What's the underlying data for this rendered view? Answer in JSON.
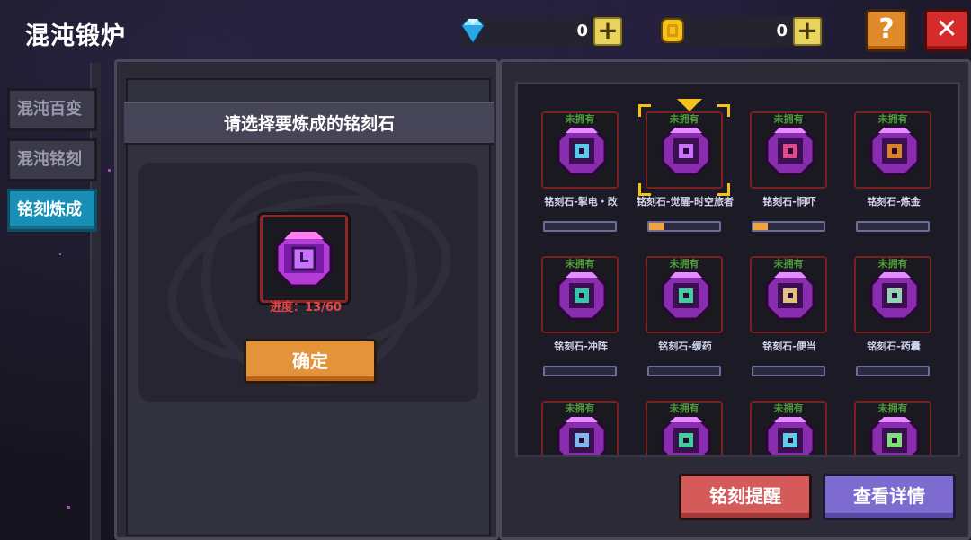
{
  "title": "混沌锻炉",
  "currency": {
    "gems": {
      "value": "0",
      "icon": "diamond-icon",
      "color": "#4fc3f7"
    },
    "coins": {
      "value": "0",
      "icon": "gold-coin-icon",
      "color": "#f4c21b"
    },
    "add_label": "+"
  },
  "help_label": "?",
  "close_label": "✕",
  "sidebar": {
    "tabs": [
      {
        "label": "混沌百变",
        "active": false
      },
      {
        "label": "混沌铭刻",
        "active": false
      },
      {
        "label": "铭刻炼成",
        "active": true
      }
    ]
  },
  "left_panel": {
    "header": "请选择要炼成的铭刻石",
    "selected_item_icon": "purple-gem-icon",
    "progress_label": "进度：13/60",
    "progress": {
      "current": 13,
      "total": 60
    },
    "confirm_label": "确定"
  },
  "grid": {
    "owned_label": "未拥有",
    "items": [
      {
        "name": "铭刻石-掣电・改",
        "icon": "lightning-rune-icon",
        "progress": 0,
        "selected": false
      },
      {
        "name": "铭刻石-觉醒-时空旅者",
        "icon": "clock-rune-icon",
        "progress": 0.217,
        "selected": true
      },
      {
        "name": "铭刻石-恫吓",
        "icon": "mask-rune-icon",
        "progress": 0.2,
        "selected": false
      },
      {
        "name": "铭刻石-炼金",
        "icon": "cauldron-rune-icon",
        "progress": 0,
        "selected": false
      },
      {
        "name": "铭刻石-冲阵",
        "icon": "charge-rune-icon",
        "progress": 0,
        "selected": false
      },
      {
        "name": "铭刻石-缓药",
        "icon": "potion-rune-icon",
        "progress": 0,
        "selected": false
      },
      {
        "name": "铭刻石-便当",
        "icon": "lunchbox-rune-icon",
        "progress": 0,
        "selected": false
      },
      {
        "name": "铭刻石-药囊",
        "icon": "pouch-rune-icon",
        "progress": 0,
        "selected": false
      },
      {
        "icon": "sword-rune-icon"
      },
      {
        "icon": "swirl-rune-icon"
      },
      {
        "icon": "shield-rune-icon"
      },
      {
        "icon": "claw-rune-icon"
      }
    ]
  },
  "buttons": {
    "remind_label": "铭刻提醒",
    "detail_label": "查看详情"
  },
  "colors": {
    "active_tab": "#1a8fb5",
    "confirm": "#e3933a",
    "remind": "#d55b5b",
    "detail": "#7d6bd0",
    "progress_fill": "#f2a341",
    "progress_text": "#e34848",
    "owned_text": "#4f9a3c"
  }
}
